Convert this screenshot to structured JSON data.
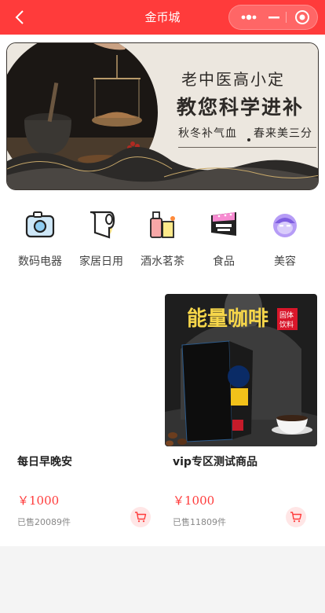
{
  "header": {
    "title": "金币城",
    "bg_color": "#ff3b3b"
  },
  "banner": {
    "line1": "老中医高小定",
    "line2": "教您科学进补",
    "line3a": "秋冬补气血",
    "line3b": "春来美三分"
  },
  "categories": [
    {
      "label": "数码电器",
      "icon": "camera-icon"
    },
    {
      "label": "家居日用",
      "icon": "tissue-roll-icon"
    },
    {
      "label": "酒水茗茶",
      "icon": "drink-bottle-icon"
    },
    {
      "label": "食品",
      "icon": "snack-icon"
    },
    {
      "label": "美容",
      "icon": "face-mask-icon"
    }
  ],
  "products": [
    {
      "name": "每日早晚安",
      "price": "￥1000",
      "sold": "已售20089件"
    },
    {
      "name": "vip专区测试商品",
      "price": "￥1000",
      "sold": "已售11809件",
      "image_text": {
        "title": "能量咖啡",
        "tag1": "固体",
        "tag2": "饮料"
      }
    }
  ]
}
